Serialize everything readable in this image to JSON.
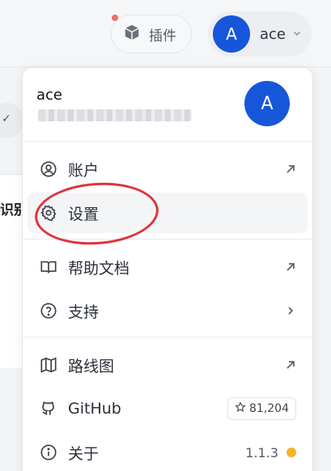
{
  "topbar": {
    "plugin_label": "插件",
    "user_initial": "A",
    "user_name": "ace"
  },
  "background": {
    "partial_text": "识别"
  },
  "menu": {
    "header": {
      "name": "ace",
      "avatar_initial": "A"
    },
    "items": [
      {
        "label": "账户",
        "icon": "user-circle-icon",
        "trail": "external-arrow"
      },
      {
        "label": "设置",
        "icon": "gear-icon",
        "trail": ""
      },
      {
        "label": "帮助文档",
        "icon": "book-icon",
        "trail": "external-arrow"
      },
      {
        "label": "支持",
        "icon": "question-circle-icon",
        "trail": "chevron-right"
      },
      {
        "label": "路线图",
        "icon": "map-icon",
        "trail": "external-arrow"
      },
      {
        "label": "GitHub",
        "icon": "github-icon",
        "stars": "81,204"
      },
      {
        "label": "关于",
        "icon": "info-icon",
        "version": "1.1.3"
      }
    ]
  },
  "colors": {
    "accent": "#1656d9",
    "annotation": "#e0333a",
    "update_dot": "#f5b324"
  }
}
